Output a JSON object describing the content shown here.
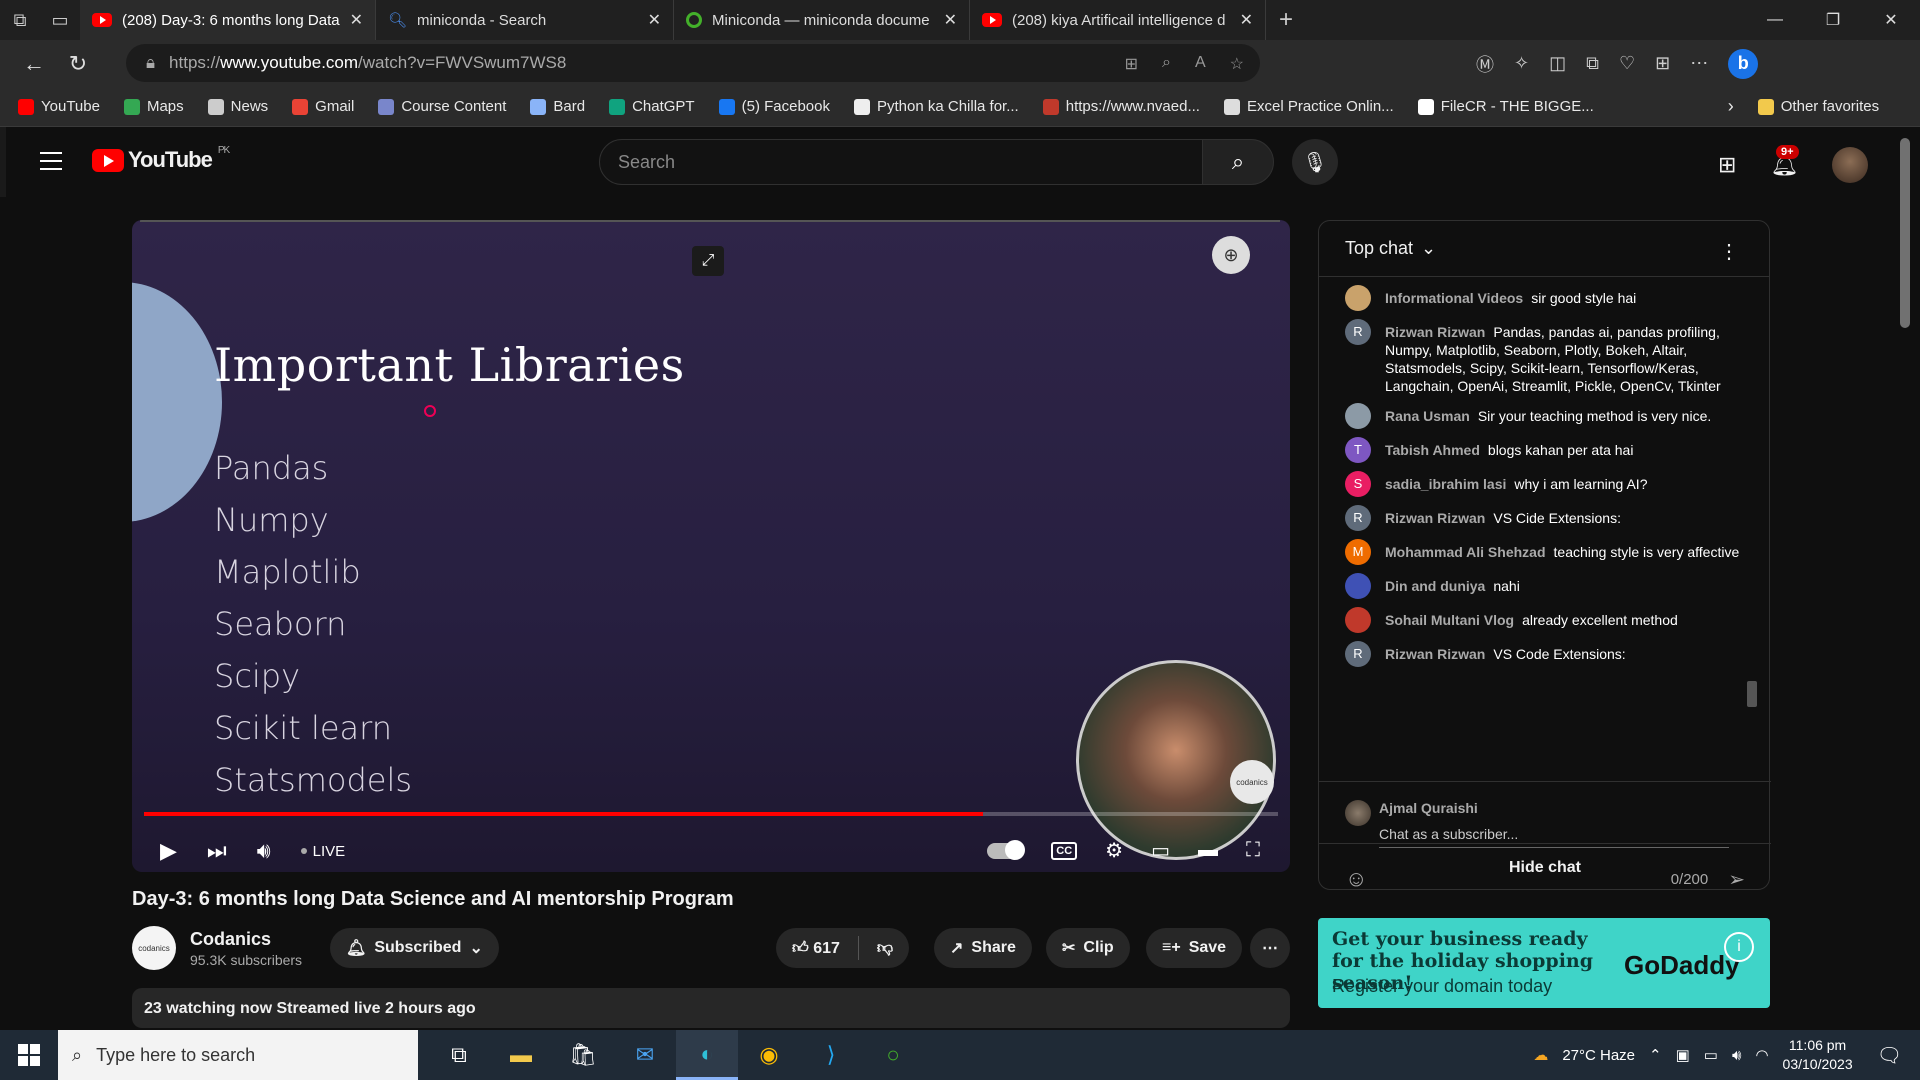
{
  "browser": {
    "tabs": [
      {
        "label": "(208) Day-3: 6 months long Data",
        "active": true,
        "icon": "youtube-icon"
      },
      {
        "label": "miniconda - Search",
        "active": false,
        "icon": "search-icon"
      },
      {
        "label": "Miniconda — miniconda docume",
        "active": false,
        "icon": "miniconda-icon"
      },
      {
        "label": "(208) kiya Artificail intelligence d",
        "active": false,
        "icon": "youtube-icon"
      }
    ],
    "url_prefix": "https://",
    "url_host": "www.youtube.com",
    "url_path": "/watch?v=FWVSwum7WS8",
    "bookmarks": [
      {
        "label": "YouTube",
        "color": "#ff0000"
      },
      {
        "label": "Maps",
        "color": "#34a853"
      },
      {
        "label": "News",
        "color": "#cccccc"
      },
      {
        "label": "Gmail",
        "color": "#ea4335"
      },
      {
        "label": "Course Content",
        "color": "#7986cb"
      },
      {
        "label": "Bard",
        "color": "#8ab4f8"
      },
      {
        "label": "ChatGPT",
        "color": "#10a37f"
      },
      {
        "label": "(5) Facebook",
        "color": "#1877f2"
      },
      {
        "label": "Python ka Chilla for...",
        "color": "#eeeeee"
      },
      {
        "label": "https://www.nvaed...",
        "color": "#c0392b"
      },
      {
        "label": "Excel Practice Onlin...",
        "color": "#dddddd"
      },
      {
        "label": "FileCR - THE BIGGE...",
        "color": "#ffffff"
      }
    ],
    "other_favorites": "Other favorites"
  },
  "youtube": {
    "logo": "YouTube",
    "region": "PK",
    "search_placeholder": "Search",
    "notif_count": "9+"
  },
  "player": {
    "slide_title": "Important Libraries",
    "libraries": [
      "Pandas",
      "Numpy",
      "Maplotlib",
      "Seaborn",
      "Scipy",
      "Scikit learn",
      "Statsmodels"
    ],
    "live_label": "LIVE",
    "progress_fraction": 0.74,
    "cam_logo": "codanics"
  },
  "video": {
    "title": "Day-3: 6 months long Data Science and AI mentorship Program",
    "channel": "Codanics",
    "subscribers": "95.3K subscribers",
    "subscribed_label": "Subscribed",
    "likes": "617",
    "share_label": "Share",
    "clip_label": "Clip",
    "save_label": "Save",
    "description_line": "23 watching now  Streamed live 2 hours ago"
  },
  "chat": {
    "header": "Top chat",
    "messages": [
      {
        "author": "Informational Videos",
        "text": "sir good style hai",
        "initial": "",
        "color": "#c9a26b"
      },
      {
        "author": "Rizwan Rizwan",
        "text": "Pandas, pandas ai, pandas profiling, Numpy, Matplotlib, Seaborn, Plotly, Bokeh, Altair, Statsmodels, Scipy, Scikit-learn, Tensorflow/Keras, Langchain, OpenAi, Streamlit, Pickle, OpenCv, Tkinter",
        "initial": "R",
        "color": "#5f6b7a"
      },
      {
        "author": "Rana Usman",
        "text": "Sir your teaching method is very nice.",
        "initial": "",
        "color": "#8c9aa6"
      },
      {
        "author": "Tabish Ahmed",
        "text": "blogs kahan per ata hai",
        "initial": "T",
        "color": "#7e57c2"
      },
      {
        "author": "sadia_ibrahim lasi",
        "text": "why i am learning AI?",
        "initial": "S",
        "color": "#e91e63"
      },
      {
        "author": "Rizwan Rizwan",
        "text": "VS Cide Extensions:",
        "initial": "R",
        "color": "#5f6b7a"
      },
      {
        "author": "Mohammad Ali Shehzad",
        "text": "teaching style is very affective",
        "initial": "M",
        "color": "#ef6c00"
      },
      {
        "author": "Din and duniya",
        "text": "nahi",
        "initial": "",
        "color": "#3f51b5"
      },
      {
        "author": "Sohail Multani Vlog",
        "text": "already excellent method",
        "initial": "",
        "color": "#c0392b"
      },
      {
        "author": "Rizwan Rizwan",
        "text": "VS Code Extensions:",
        "initial": "R",
        "color": "#5f6b7a"
      }
    ],
    "current_user": "Ajmal Quraishi",
    "input_placeholder": "Chat as a subscriber...",
    "char_count": "0/200",
    "hide_chat": "Hide chat"
  },
  "ad": {
    "line1": "Get your business ready for the holiday shopping season!",
    "line2": "Register your domain today",
    "brand": "GoDaddy"
  },
  "taskbar": {
    "search_placeholder": "Type here to search",
    "weather": "27°C  Haze",
    "time": "11:06 pm",
    "date": "03/10/2023"
  }
}
